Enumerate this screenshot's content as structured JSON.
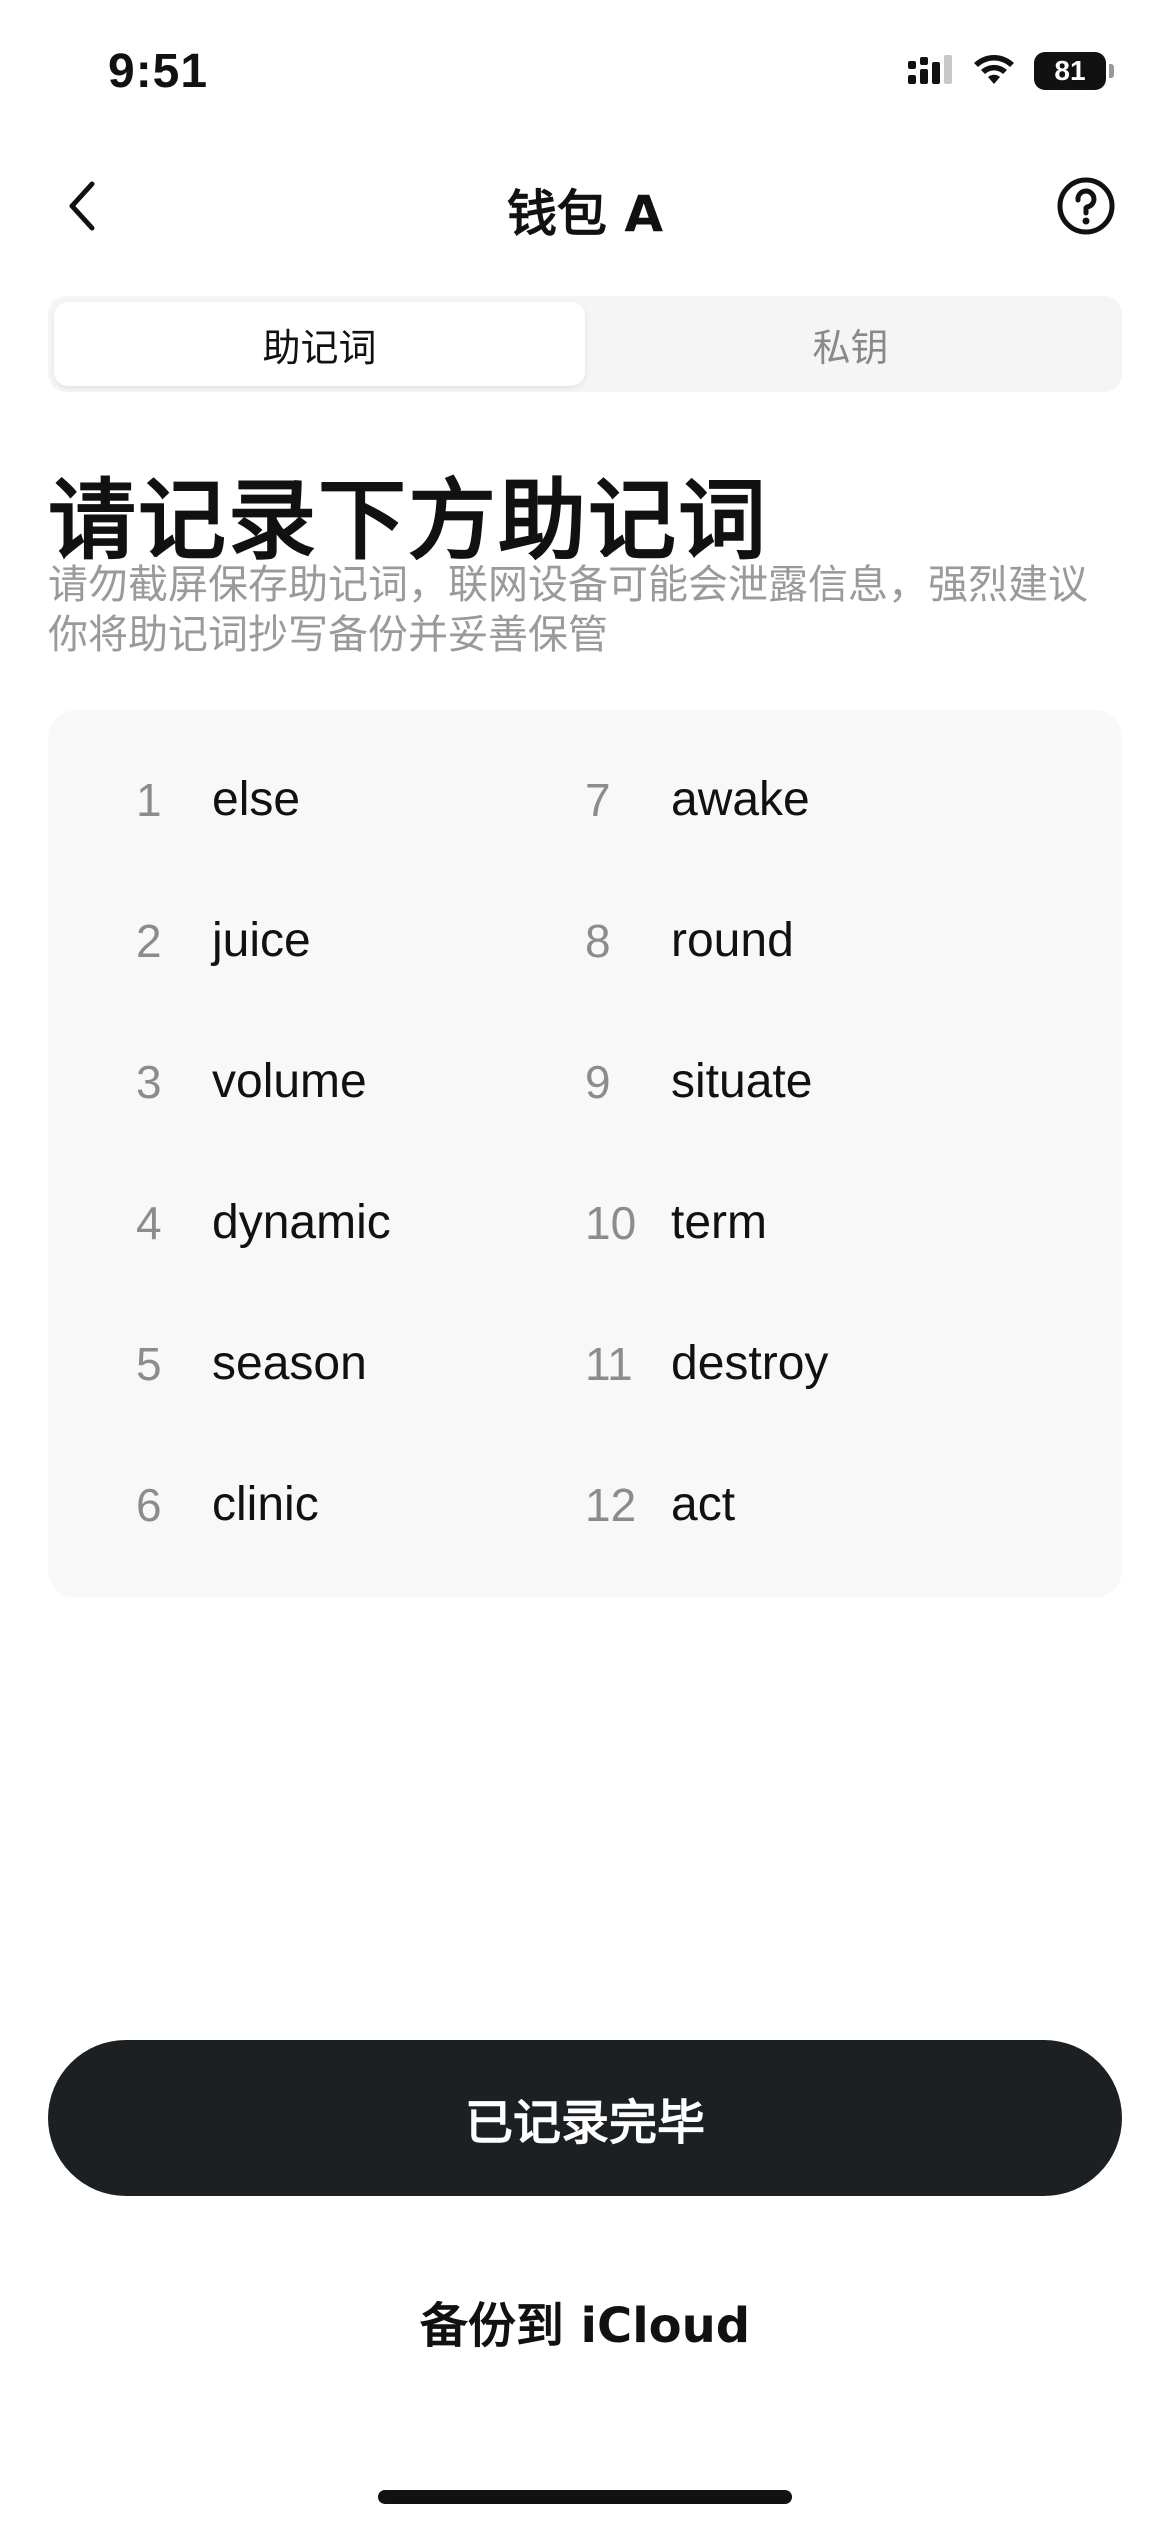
{
  "status_bar": {
    "time": "9:51",
    "battery": "81",
    "icons": [
      "cellular-signal-icon",
      "wifi-icon",
      "battery-icon"
    ]
  },
  "nav": {
    "title": "钱包 A",
    "back_icon": "chevron-left-icon",
    "help_icon": "question-circle-icon"
  },
  "tabs": [
    {
      "label": "助记词",
      "active": true
    },
    {
      "label": "私钥",
      "active": false
    }
  ],
  "heading": "请记录下方助记词",
  "subtext": "请勿截屏保存助记词，联网设备可能会泄露信息，强烈建议你将助记词抄写备份并妥善保管",
  "words": [
    {
      "n": "1",
      "w": "else"
    },
    {
      "n": "2",
      "w": "juice"
    },
    {
      "n": "3",
      "w": "volume"
    },
    {
      "n": "4",
      "w": "dynamic"
    },
    {
      "n": "5",
      "w": "season"
    },
    {
      "n": "6",
      "w": "clinic"
    },
    {
      "n": "7",
      "w": "awake"
    },
    {
      "n": "8",
      "w": "round"
    },
    {
      "n": "9",
      "w": "situate"
    },
    {
      "n": "10",
      "w": "term"
    },
    {
      "n": "11",
      "w": "destroy"
    },
    {
      "n": "12",
      "w": "act"
    }
  ],
  "primary_button": "已记录完毕",
  "secondary_link": "备份到 iCloud",
  "colors": {
    "primary_button_bg": "#1d2023",
    "card_bg": "#f8f8f8",
    "muted_text": "#9a9a9a"
  }
}
